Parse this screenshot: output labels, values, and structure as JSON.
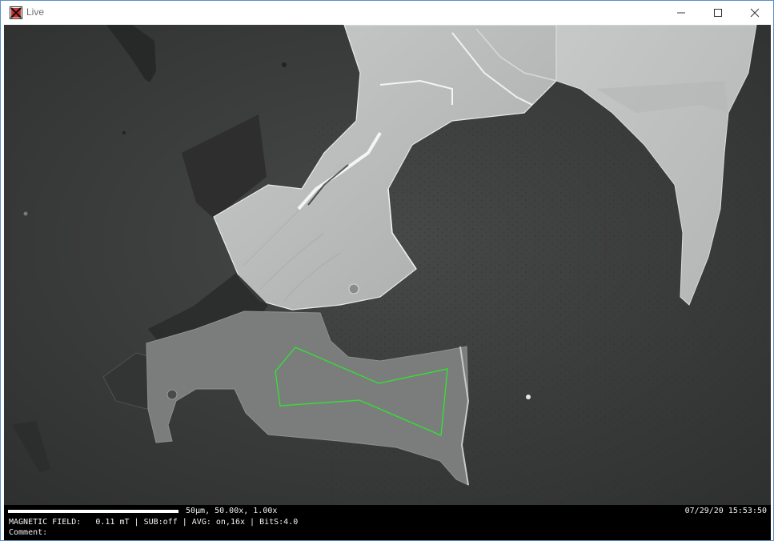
{
  "window": {
    "title": "Live",
    "icons": [
      "app-icon",
      "minimize-icon",
      "maximize-icon",
      "close-icon"
    ]
  },
  "colors": {
    "roi_outline": "#2ee62e",
    "background": "#3c3d3d",
    "status_bg": "#000000",
    "status_text": "#f2f2f2"
  },
  "view": {
    "roi_shape": "polygon"
  },
  "status": {
    "scale_label": "50μm, 50.00x, 1.00x",
    "timestamp": "07/29/20 15:53:50",
    "field_line": "MAGNETIC FIELD:   0.11 mT | SUB:off | AVG: on,16x | BitS:4.0",
    "comment_label": "Comment:"
  }
}
